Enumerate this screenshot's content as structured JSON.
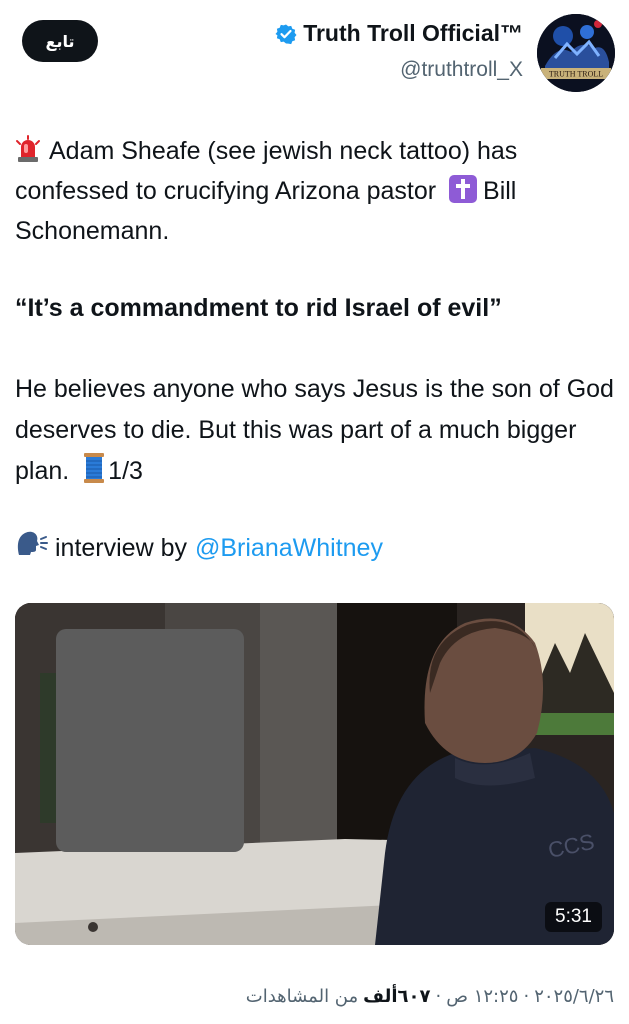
{
  "header": {
    "follow_label": "تابع",
    "display_name": "Truth Troll Official™",
    "handle": "@truthtroll_X",
    "avatar_caption": "TRUTH TROLL"
  },
  "tweet": {
    "line1": "Adam Sheafe (see jewish neck tattoo) has confessed to crucifying Arizona pastor",
    "line1_tail": "Bill Schonemann.",
    "quote": "“It’s a commandment to rid Israel of evil”",
    "para2": " He believes anyone who says Jesus is the son of God deserves to die. But this was part of a much bigger plan.",
    "para2_tail": "1/3",
    "interview_prefix": "interview by",
    "mention": "@BrianaWhitney"
  },
  "video": {
    "duration": "5:31",
    "jersey_text": "CCS"
  },
  "meta": {
    "date": "٢٠٢٥/٦/٢٦",
    "separator": "·",
    "time": "١٢:٢٥ ص",
    "views_count": "٦٠٧ألف",
    "views_label": "من المشاهدات"
  },
  "colors": {
    "link": "#1d9bf0",
    "text": "#0f1419",
    "muted": "#536471",
    "verified": "#1d9bf0"
  },
  "icons": {
    "siren": "rotating-light-emoji",
    "cross": "latin-cross-emoji",
    "thread": "spool-of-thread-emoji",
    "speaking": "speaking-head-emoji",
    "verified": "verified-badge-icon"
  }
}
